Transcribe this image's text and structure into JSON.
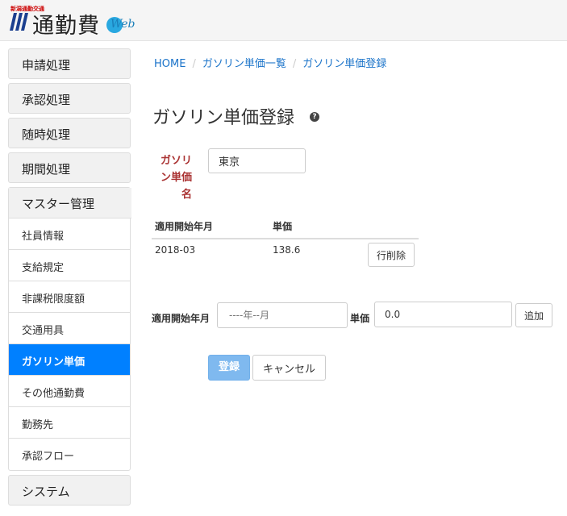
{
  "header": {
    "logo_small": "新潟通勤交通",
    "app_title": "通勤費",
    "logo_suffix": "Web"
  },
  "sidebar": {
    "groups": [
      {
        "label": "申請処理"
      },
      {
        "label": "承認処理"
      },
      {
        "label": "随時処理"
      },
      {
        "label": "期間処理"
      }
    ],
    "master": {
      "label": "マスター管理",
      "items": [
        {
          "label": "社員情報"
        },
        {
          "label": "支給規定"
        },
        {
          "label": "非課税限度額"
        },
        {
          "label": "交通用具"
        },
        {
          "label": "ガソリン単価",
          "active": true
        },
        {
          "label": "その他通勤費"
        },
        {
          "label": "勤務先"
        },
        {
          "label": "承認フロー"
        }
      ]
    },
    "system": {
      "label": "システム"
    }
  },
  "breadcrumb": {
    "home": "HOME",
    "list": "ガソリン単価一覧",
    "current": "ガソリン単価登録",
    "separator": "/"
  },
  "page": {
    "title": "ガソリン単価登録",
    "help": "?"
  },
  "form": {
    "name_label_lines": [
      "ガソリ",
      "ン単価",
      "名"
    ],
    "name_value": "東京"
  },
  "table": {
    "headers": [
      "適用開始年月",
      "単価"
    ],
    "rows": [
      {
        "start": "2018-03",
        "price": "138.6",
        "delete_label": "行削除"
      }
    ]
  },
  "add_row": {
    "start_label": "適用開始年月",
    "start_placeholder": "----年--月",
    "price_label": "単価",
    "price_value": "0.0",
    "add_label": "追加"
  },
  "actions": {
    "register": "登録",
    "cancel": "キャンセル"
  },
  "colors": {
    "active_menu": "#0080ff",
    "link": "#1a73c9",
    "required_label": "#aa3333",
    "primary_button": "#7fb9ef"
  }
}
